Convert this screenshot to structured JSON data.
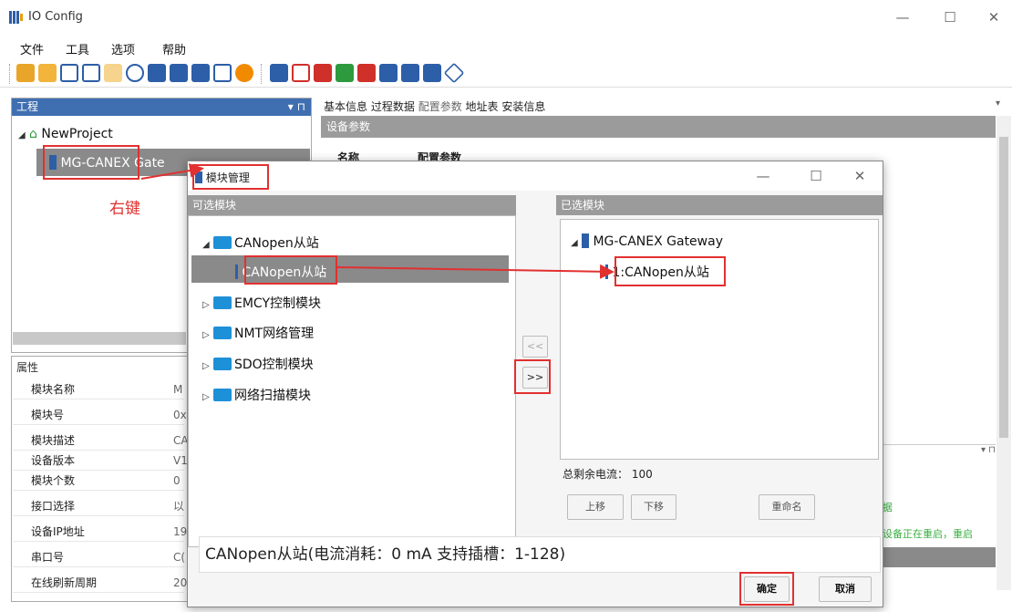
{
  "window": {
    "title": "IO Config",
    "min": "—",
    "max": "☐",
    "close": "✕"
  },
  "menu": [
    "文件",
    "工具",
    "选项",
    "帮助"
  ],
  "colors": {
    "accent": "#3f6fb1",
    "red": "#e23030",
    "folder": "#1e90d8"
  },
  "left_panel": {
    "header": "工程",
    "project": "NewProject",
    "device": "MG-CANEX Gate",
    "annotation": "右键"
  },
  "props": {
    "header": "属性",
    "rows": [
      {
        "k": "模块名称",
        "v": "M"
      },
      {
        "k": "模块号",
        "v": "0x"
      },
      {
        "k": "模块描述",
        "v": "CA"
      },
      {
        "k": "设备版本",
        "v": "V1"
      },
      {
        "k": "模块个数",
        "v": "0"
      },
      {
        "k": "接口选择",
        "v": "以"
      },
      {
        "k": "设备IP地址",
        "v": "19"
      },
      {
        "k": "串口号",
        "v": "C("
      },
      {
        "k": "在线刷新周期",
        "v": "20"
      }
    ]
  },
  "right_panel": {
    "tabs": [
      "基本信息",
      "过程数据",
      "配置参数",
      "地址表",
      "安装信息"
    ],
    "section": "设备参数",
    "col1": "名称",
    "col2": "配置参数",
    "partial_text": "据",
    "partial_text2": "设备正在重启，重启"
  },
  "dialog": {
    "title": "模块管理",
    "available_header": "可选模块",
    "selected_header": "已选模块",
    "available": [
      {
        "label": "CANopen从站",
        "expanded": true,
        "children": [
          "CANopen从站"
        ]
      },
      {
        "label": "EMCY控制模块"
      },
      {
        "label": "NMT网络管理"
      },
      {
        "label": "SDO控制模块"
      },
      {
        "label": "网络扫描模块"
      }
    ],
    "selected_root": "MG-CANEX Gateway",
    "selected_child": "1:CANopen从站",
    "left_arrow": "<<",
    "right_arrow": ">>",
    "current_label": "总剩余电流：",
    "current_value": "100",
    "btn_up": "上移",
    "btn_down": "下移",
    "btn_rename": "重命名",
    "description": "CANopen从站(电流消耗：0 mA  支持插槽：1-128)",
    "ok": "确定",
    "cancel": "取消"
  }
}
